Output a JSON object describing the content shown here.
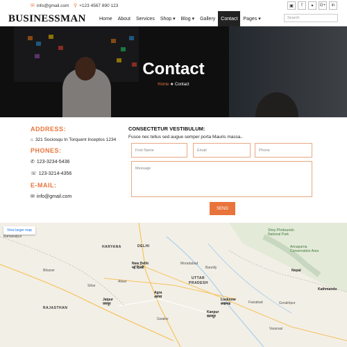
{
  "topbar": {
    "email": "info@gmail.com",
    "phone": "+123 4567 890 123",
    "social": [
      "rss-icon",
      "facebook-icon",
      "twitter-icon",
      "google-plus-icon",
      "linkedin-icon"
    ],
    "social_glyphs": [
      "▣",
      "f",
      "✦",
      "G+",
      "in"
    ]
  },
  "navbar": {
    "logo": "BUSINESSMAN",
    "items": [
      {
        "label": "Home",
        "active": false
      },
      {
        "label": "About",
        "active": false
      },
      {
        "label": "Services",
        "active": false
      },
      {
        "label": "Shop ▾",
        "active": false
      },
      {
        "label": "Blog ▾",
        "active": false
      },
      {
        "label": "Gallery",
        "active": false
      },
      {
        "label": "Contact",
        "active": true
      },
      {
        "label": "Pages ▾",
        "active": false
      }
    ],
    "search_placeholder": "Search"
  },
  "hero": {
    "title": "Contact",
    "breadcrumb_home": "Home",
    "breadcrumb_sep": "★",
    "breadcrumb_current": "Contact"
  },
  "contact_info": {
    "address_label": "ADDRESS:",
    "address": "321 Sociosqu In Torquent Inceptos 1234",
    "phones_label": "PHONES:",
    "phone1": "123-3234-5436",
    "phone2": "123-3214-4356",
    "email_label": "E-MAIL:",
    "email": "info@gmail.com"
  },
  "form": {
    "title": "CONSECTETUR VESTIBULUM:",
    "subtitle": "Fusce nec tellus sed augue semper porta Mauris massa..",
    "first_name_placeholder": "First Name",
    "email_placeholder": "Email",
    "phone_placeholder": "Phone",
    "message_placeholder": "Message",
    "send_label": "SEND"
  },
  "map": {
    "view_larger": "View larger map",
    "labels": [
      {
        "t": "HARYANA",
        "cls": "b"
      },
      {
        "t": "DELHI",
        "cls": "b"
      },
      {
        "t": "New Delhi",
        "cls": "c"
      },
      {
        "t": "नई दिल्ली",
        "cls": "c"
      },
      {
        "t": "UTTAR",
        "cls": "b"
      },
      {
        "t": "PRADESH",
        "cls": "b"
      },
      {
        "t": "RAJASTHAN",
        "cls": "b"
      },
      {
        "t": "Nepal",
        "cls": "c"
      },
      {
        "t": "Lucknow",
        "cls": "c"
      },
      {
        "t": "लखनऊ",
        "cls": "c"
      },
      {
        "t": "Kanpur",
        "cls": "c"
      },
      {
        "t": "कानपुर",
        "cls": "c"
      },
      {
        "t": "Agra",
        "cls": "c"
      },
      {
        "t": "आगरा",
        "cls": "c"
      },
      {
        "t": "Jaipur",
        "cls": "c"
      },
      {
        "t": "जयपुर",
        "cls": "c"
      },
      {
        "t": "Kathmandu",
        "cls": "c"
      },
      {
        "t": "Bahawalpur",
        "cls": ""
      },
      {
        "t": "Bikaner",
        "cls": ""
      },
      {
        "t": "Moradabad",
        "cls": ""
      },
      {
        "t": "Bareilly",
        "cls": ""
      },
      {
        "t": "Gwalior",
        "cls": ""
      },
      {
        "t": "Sikar",
        "cls": ""
      },
      {
        "t": "Alwar",
        "cls": ""
      },
      {
        "t": "Gorakhpur",
        "cls": ""
      },
      {
        "t": "Faizabad",
        "cls": ""
      },
      {
        "t": "Shey Phoksundo National Park",
        "cls": ""
      },
      {
        "t": "Annapurna Conservation Area",
        "cls": ""
      },
      {
        "t": "Varanasi",
        "cls": ""
      }
    ]
  }
}
